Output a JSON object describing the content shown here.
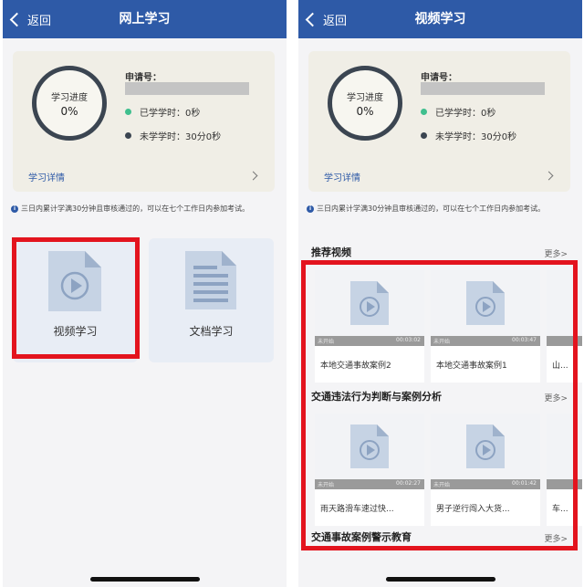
{
  "left": {
    "nav": {
      "back": "返回",
      "title": "网上学习"
    },
    "progress": {
      "title": "学习进度",
      "percent": "0%"
    },
    "application_label": "申请号：",
    "stats": [
      {
        "label": "已学学时：0秒",
        "color": "#3fbf8e"
      },
      {
        "label": "未学学时：30分0秒",
        "color": "#3b4551"
      }
    ],
    "detail_link": "学习详情",
    "notice": "三日内累计学满30分钟且审核通过的，可以在七个工作日内参加考试。",
    "tiles": [
      {
        "label": "视频学习",
        "icon": "video-file-icon"
      },
      {
        "label": "文档学习",
        "icon": "document-icon"
      }
    ]
  },
  "right": {
    "nav": {
      "back": "返回",
      "title": "视频学习"
    },
    "progress": {
      "title": "学习进度",
      "percent": "0%"
    },
    "application_label": "申请号：",
    "stats": [
      {
        "label": "已学学时：0秒",
        "color": "#3fbf8e"
      },
      {
        "label": "未学学时：30分0秒",
        "color": "#3b4551"
      }
    ],
    "detail_link": "学习详情",
    "notice": "三日内累计学满30分钟且审核通过的，可以在七个工作日内参加考试。",
    "sections": [
      {
        "title": "推荐视频",
        "more": "更多>",
        "videos": [
          {
            "status": "未开始",
            "duration": "00:03:02",
            "title": "本地交通事故案例2"
          },
          {
            "status": "未开始",
            "duration": "00:03:47",
            "title": "本地交通事故案例1"
          },
          {
            "status": "",
            "duration": "",
            "title": "山..."
          }
        ]
      },
      {
        "title": "交通违法行为判断与案例分析",
        "more": "更多>",
        "videos": [
          {
            "status": "未开始",
            "duration": "00:02:27",
            "title": "雨天路滑车速过快..."
          },
          {
            "status": "未开始",
            "duration": "00:01:42",
            "title": "男子逆行闯入大货..."
          },
          {
            "status": "",
            "duration": "",
            "title": "车..."
          }
        ]
      },
      {
        "title": "交通事故案例警示教育",
        "more": "更多>"
      }
    ]
  },
  "colors": {
    "nav": "#2e5aa7",
    "highlight": "#e3141e"
  }
}
